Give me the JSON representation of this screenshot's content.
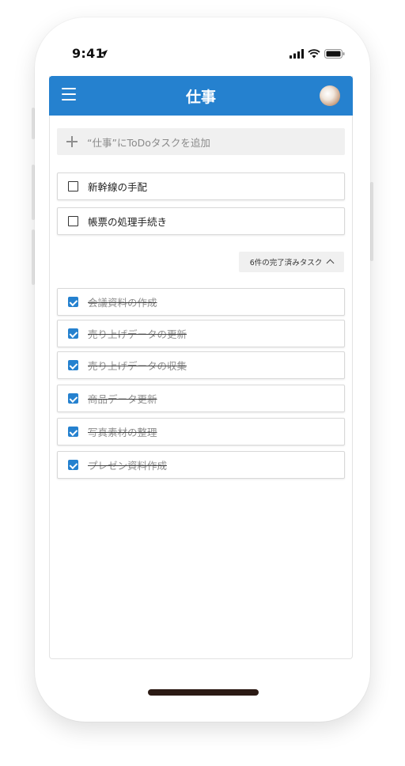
{
  "status_bar": {
    "time": "9:41"
  },
  "app_bar": {
    "title": "仕事"
  },
  "add_task": {
    "placeholder": "“仕事”にToDoタスクを追加"
  },
  "tasks": [
    {
      "label": "新幹線の手配"
    },
    {
      "label": "帳票の処理手続き"
    }
  ],
  "completed_toggle": {
    "label": "6件の完了済みタスク"
  },
  "completed_tasks": [
    {
      "label": "会議資料の作成"
    },
    {
      "label": "売り上げデータの更新"
    },
    {
      "label": "売り上げデータの収集"
    },
    {
      "label": "商品データ更新"
    },
    {
      "label": "写真素材の整理"
    },
    {
      "label": "プレゼン資料作成"
    }
  ],
  "colors": {
    "accent": "#2581cf"
  }
}
